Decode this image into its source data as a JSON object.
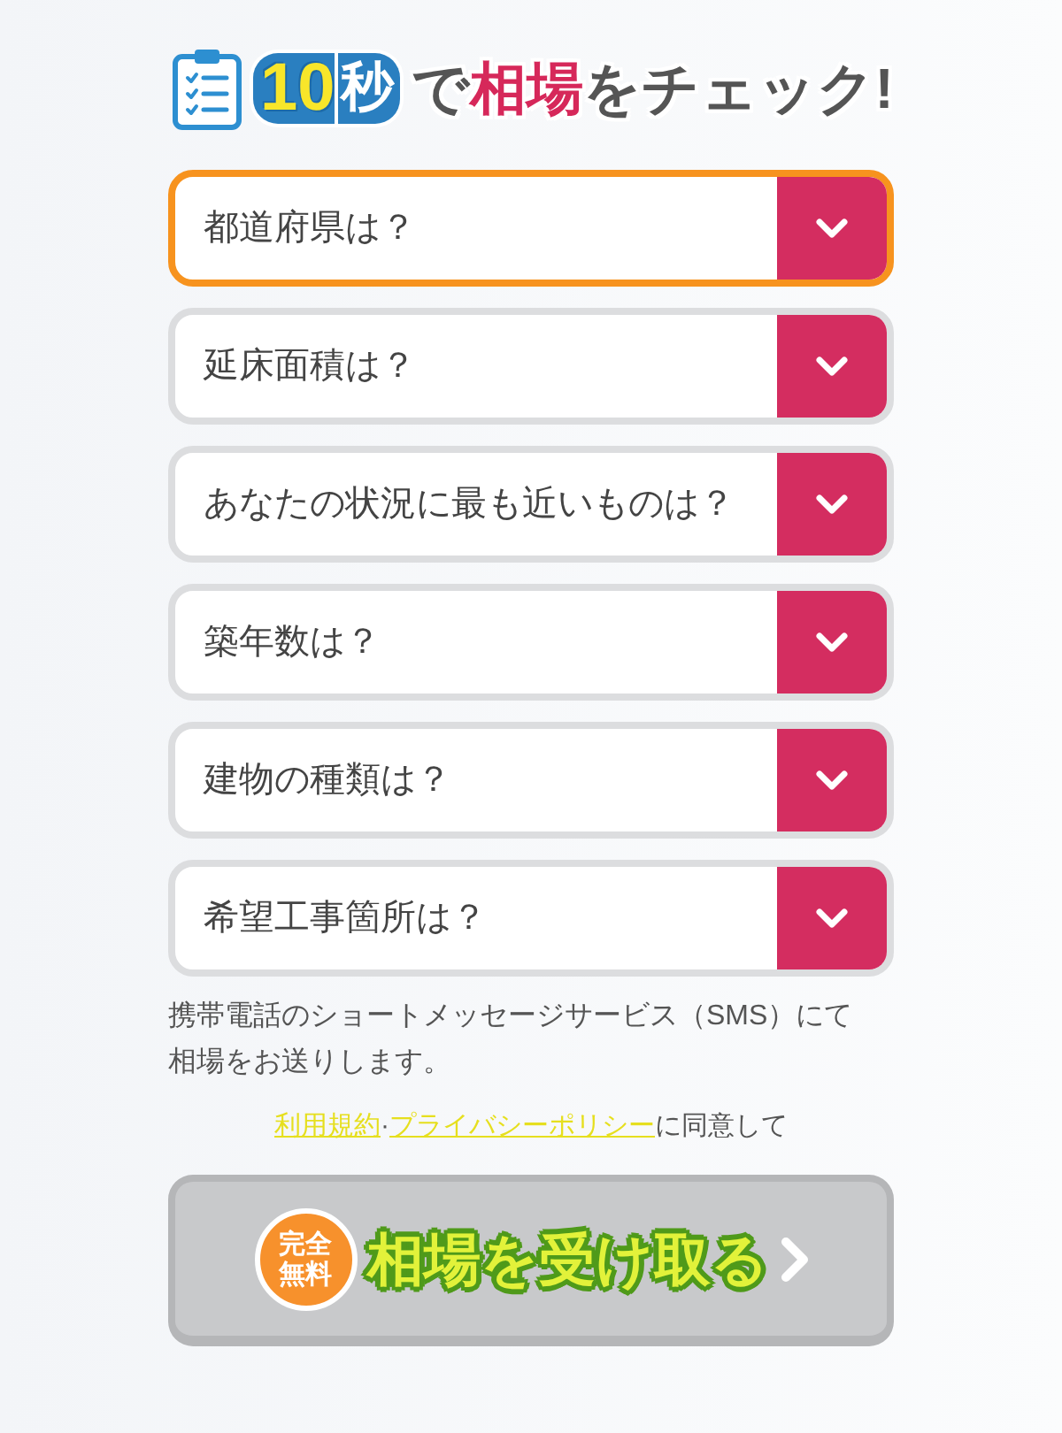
{
  "heading": {
    "segments": [
      {
        "text": "10",
        "kind": "number"
      },
      {
        "text": "秒",
        "kind": "unit"
      },
      {
        "text": "で",
        "kind": "plain"
      },
      {
        "text": "相場",
        "kind": "accent"
      },
      {
        "text": "をチェック!",
        "kind": "plain"
      }
    ]
  },
  "form": {
    "fields": [
      {
        "placeholder": "都道府県は？",
        "active": true
      },
      {
        "placeholder": "延床面積は？",
        "active": false
      },
      {
        "placeholder": "あなたの状況に最も近いものは？",
        "active": false
      },
      {
        "placeholder": "築年数は？",
        "active": false
      },
      {
        "placeholder": "建物の種類は？",
        "active": false
      },
      {
        "placeholder": "希望工事箇所は？",
        "active": false
      }
    ]
  },
  "note": "携帯電話のショートメッセージサービス（SMS）にて相場をお送りします。",
  "consent": {
    "terms_link": "利用規約",
    "separator": "·",
    "privacy_link": "プライバシーポリシー",
    "suffix": "に同意して"
  },
  "submit_button": {
    "badge": "完全無料",
    "label": "相場を受け取る",
    "disabled": true
  }
}
